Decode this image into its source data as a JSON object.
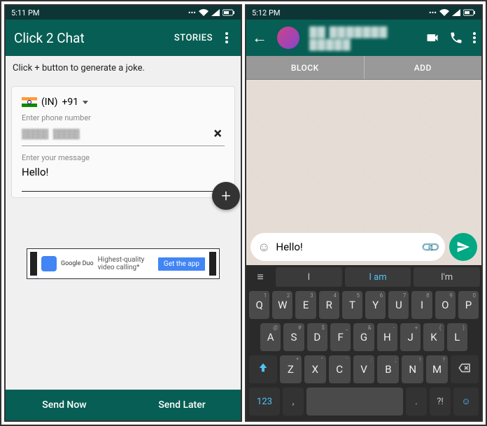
{
  "left": {
    "status_time": "5:11 PM",
    "app_title": "Click 2 Chat",
    "stories_label": "STORIES",
    "hint_text": "Click + button to generate a joke.",
    "country_code_label": "(IN)",
    "dial_code": "+91",
    "phone_label": "Enter phone number",
    "phone_value": "▓▓▓▓▓ ▓▓▓▓▓",
    "message_label": "Enter your message",
    "message_value": "Hello!",
    "ad": {
      "brand": "Google Duo",
      "text": "Highest-quality video calling*",
      "cta": "Get the app"
    },
    "send_now": "Send Now",
    "send_later": "Send Later"
  },
  "right": {
    "status_time": "5:12 PM",
    "contact_name": "▓▓ ▓▓▓▓▓▓▓ ▓▓▓▓▓",
    "block_label": "BLOCK",
    "add_label": "ADD",
    "input_value": "Hello!",
    "suggestions": [
      "I",
      "I am",
      "I'm"
    ],
    "keys_row1": [
      {
        "k": "Q",
        "s": "1"
      },
      {
        "k": "W",
        "s": "2"
      },
      {
        "k": "E",
        "s": "3"
      },
      {
        "k": "R",
        "s": "4"
      },
      {
        "k": "T",
        "s": "5"
      },
      {
        "k": "Y",
        "s": "6"
      },
      {
        "k": "U",
        "s": "7"
      },
      {
        "k": "I",
        "s": "8"
      },
      {
        "k": "O",
        "s": "9"
      },
      {
        "k": "P",
        "s": "0"
      }
    ],
    "keys_row2": [
      {
        "k": "A",
        "s": "@"
      },
      {
        "k": "S",
        "s": "#"
      },
      {
        "k": "D",
        "s": "$"
      },
      {
        "k": "F",
        "s": "_"
      },
      {
        "k": "G",
        "s": "&"
      },
      {
        "k": "H",
        "s": "-"
      },
      {
        "k": "J",
        "s": "+"
      },
      {
        "k": "K",
        "s": "("
      },
      {
        "k": "L",
        "s": ")"
      }
    ],
    "keys_row3": [
      {
        "k": "Z",
        "s": "*"
      },
      {
        "k": "X",
        "s": "\""
      },
      {
        "k": "C",
        "s": "'"
      },
      {
        "k": "V",
        "s": ":"
      },
      {
        "k": "B",
        "s": ";"
      },
      {
        "k": "N",
        "s": "!"
      },
      {
        "k": "M",
        "s": "?"
      }
    ],
    "key_123": "123",
    "key_comma": ",",
    "key_period": ".",
    "key_enter_hint": "?!"
  }
}
